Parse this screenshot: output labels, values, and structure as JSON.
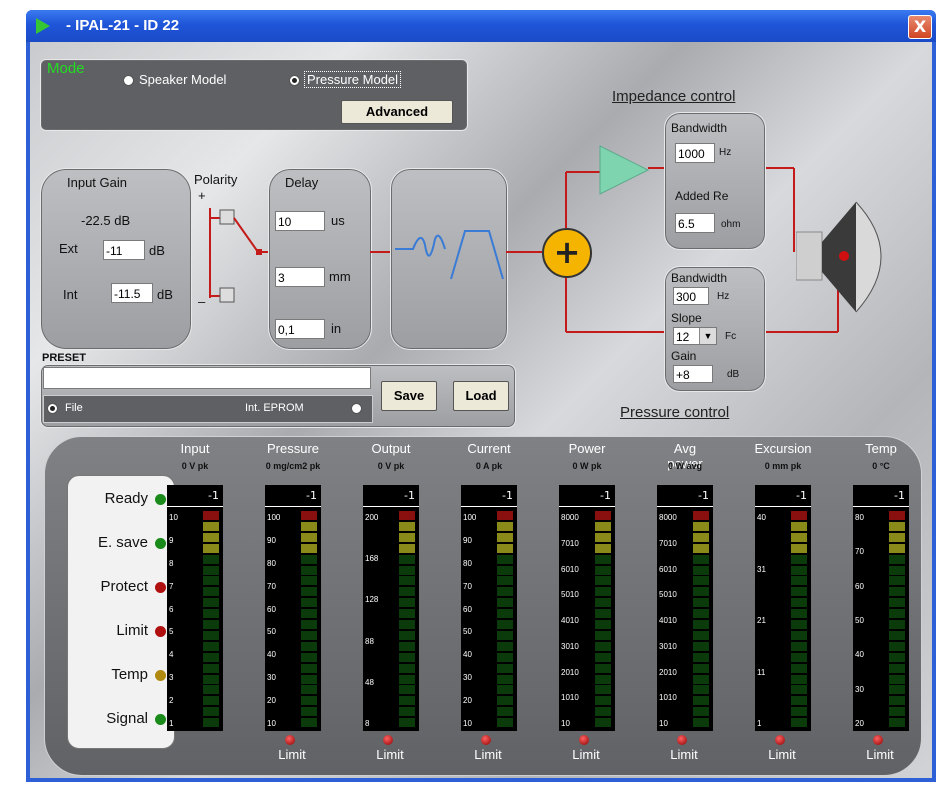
{
  "window": {
    "title": "- IPAL-21 - ID 22",
    "close_label": "X"
  },
  "mode": {
    "title": "Mode",
    "option_speaker": "Speaker Model",
    "option_pressure": "Pressure Model",
    "selected": "Pressure Model",
    "advanced_label": "Advanced"
  },
  "input_gain": {
    "title": "Input Gain",
    "value": "-22.5 dB",
    "ext_label": "Ext",
    "ext_value": "-11",
    "ext_unit": "dB",
    "int_label": "Int",
    "int_value": "-11.5",
    "int_unit": "dB"
  },
  "polarity": {
    "title": "Polarity",
    "plus": "+",
    "minus": "–"
  },
  "delay": {
    "title": "Delay",
    "us_value": "10",
    "us_unit": "us",
    "mm_value": "3",
    "mm_unit": "mm",
    "in_value": "0,1",
    "in_unit": "in"
  },
  "impedance": {
    "title": "Impedance control",
    "bandwidth_label": "Bandwidth",
    "bandwidth_value": "1000",
    "bandwidth_unit": "Hz",
    "added_re_label": "Added Re",
    "added_re_value": "6.5",
    "added_re_unit": "ohm"
  },
  "pressure": {
    "title": "Pressure control",
    "bandwidth_label": "Bandwidth",
    "bandwidth_value": "300",
    "bandwidth_unit": "Hz",
    "slope_label": "Slope",
    "slope_value": "12",
    "slope_unit": "Fc",
    "gain_label": "Gain",
    "gain_value": "+8",
    "gain_unit": "dB"
  },
  "summing_symbol": "+",
  "preset": {
    "title": "PRESET",
    "name_value": "",
    "file_label": "File",
    "eprom_label": "Int. EPROM",
    "selected": "File",
    "save_label": "Save",
    "load_label": "Load"
  },
  "status": [
    {
      "label": "Ready",
      "color": "#1a8a1a"
    },
    {
      "label": "E. save",
      "color": "#1a8a1a"
    },
    {
      "label": "Protect",
      "color": "#b01010"
    },
    {
      "label": "Limit",
      "color": "#b01010"
    },
    {
      "label": "Temp",
      "color": "#b08a10"
    },
    {
      "label": "Signal",
      "color": "#1a8a1a"
    }
  ],
  "meters": [
    {
      "name": "Input",
      "reading": "0 V pk",
      "value": "-1",
      "ticks": [
        "10",
        "9",
        "8",
        "7",
        "6",
        "5",
        "4",
        "3",
        "2",
        "1"
      ],
      "limit": ""
    },
    {
      "name": "Pressure",
      "reading": "0 mg/cm2 pk",
      "value": "-1",
      "ticks": [
        "100",
        "90",
        "80",
        "70",
        "60",
        "50",
        "40",
        "30",
        "20",
        "10"
      ],
      "limit": "Limit"
    },
    {
      "name": "Output",
      "reading": "0 V pk",
      "value": "-1",
      "ticks": [
        "200",
        "168",
        "128",
        "88",
        "48",
        "8"
      ],
      "limit": "Limit"
    },
    {
      "name": "Current",
      "reading": "0 A pk",
      "value": "-1",
      "ticks": [
        "100",
        "90",
        "80",
        "70",
        "60",
        "50",
        "40",
        "30",
        "20",
        "10"
      ],
      "limit": "Limit"
    },
    {
      "name": "Power",
      "reading": "0 W pk",
      "value": "-1",
      "ticks": [
        "8000",
        "7010",
        "6010",
        "5010",
        "4010",
        "3010",
        "2010",
        "1010",
        "10"
      ],
      "limit": "Limit"
    },
    {
      "name": "Avg power",
      "reading": "0 W avg",
      "value": "-1",
      "ticks": [
        "8000",
        "7010",
        "6010",
        "5010",
        "4010",
        "3010",
        "2010",
        "1010",
        "10"
      ],
      "limit": "Limit"
    },
    {
      "name": "Excursion",
      "reading": "0 mm pk",
      "value": "-1",
      "ticks": [
        "40",
        "31",
        "21",
        "11",
        "1"
      ],
      "limit": "Limit"
    },
    {
      "name": "Temp",
      "reading": "0 °C",
      "value": "-1",
      "ticks": [
        "80",
        "70",
        "60",
        "50",
        "40",
        "30",
        "20"
      ],
      "limit": "Limit"
    }
  ],
  "colors": {
    "signal_line": "#c41a1a",
    "summer": "#f4b400",
    "amp": "#7fd4b0",
    "mode_title": "#22dd22"
  }
}
